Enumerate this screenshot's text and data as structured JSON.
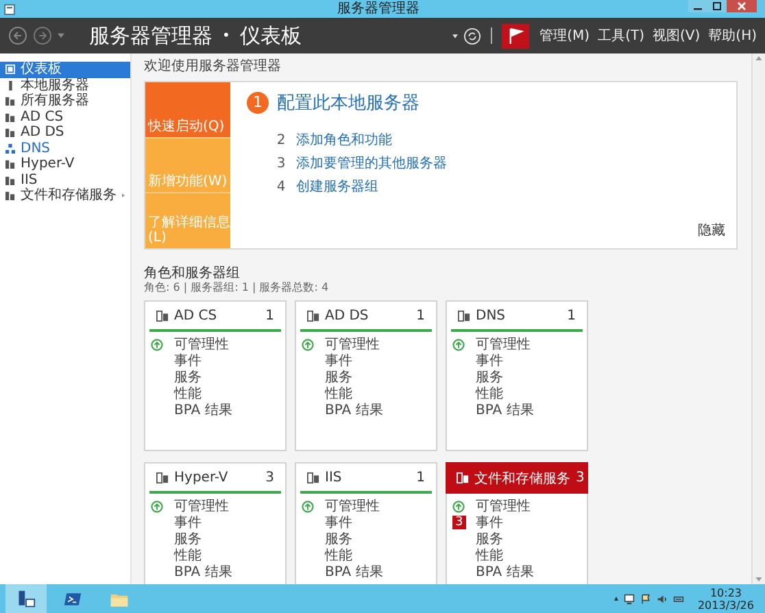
{
  "window": {
    "title": "服务器管理器"
  },
  "header": {
    "title": "服务器管理器",
    "separator": "•",
    "page": "仪表板",
    "menus": [
      "管理(M)",
      "工具(T)",
      "视图(V)",
      "帮助(H)"
    ]
  },
  "sidebar": {
    "items": [
      {
        "label": "仪表板",
        "selected": true,
        "highlighted": false,
        "expandable": false
      },
      {
        "label": "本地服务器",
        "selected": false,
        "highlighted": false,
        "expandable": false
      },
      {
        "label": "所有服务器",
        "selected": false,
        "highlighted": false,
        "expandable": false
      },
      {
        "label": "AD CS",
        "selected": false,
        "highlighted": false,
        "expandable": false
      },
      {
        "label": "AD DS",
        "selected": false,
        "highlighted": false,
        "expandable": false
      },
      {
        "label": "DNS",
        "selected": false,
        "highlighted": true,
        "expandable": false
      },
      {
        "label": "Hyper-V",
        "selected": false,
        "highlighted": false,
        "expandable": false
      },
      {
        "label": "IIS",
        "selected": false,
        "highlighted": false,
        "expandable": false
      },
      {
        "label": "文件和存储服务",
        "selected": false,
        "highlighted": false,
        "expandable": true
      }
    ]
  },
  "welcome": {
    "heading": "欢迎使用服务器管理器",
    "tabs": [
      {
        "label": "快速启动(Q)",
        "selected": true
      },
      {
        "label": "新增功能(W)",
        "selected": false
      },
      {
        "label": "了解详细信息(L)",
        "selected": false
      }
    ],
    "steps": [
      {
        "number": "1",
        "label": "配置此本地服务器",
        "kind": "primary"
      },
      {
        "number": "2",
        "label": "添加角色和功能",
        "kind": "secondary"
      },
      {
        "number": "3",
        "label": "添加要管理的其他服务器",
        "kind": "secondary"
      },
      {
        "number": "4",
        "label": "创建服务器组",
        "kind": "secondary"
      }
    ],
    "hide_link": "隐藏"
  },
  "groups": {
    "heading": "角色和服务器组",
    "summary": "角色: 6 | 服务器组: 1 | 服务器总数: 4",
    "tiles": [
      {
        "name": "AD CS",
        "count": "1",
        "kind": "ok",
        "rows": [
          {
            "label": "可管理性",
            "kind": "status"
          },
          {
            "label": "事件",
            "kind": "item"
          },
          {
            "label": "服务",
            "kind": "item"
          },
          {
            "label": "性能",
            "kind": "item"
          },
          {
            "label": "BPA 结果",
            "kind": "item"
          }
        ]
      },
      {
        "name": "AD DS",
        "count": "1",
        "kind": "ok",
        "rows": [
          {
            "label": "可管理性",
            "kind": "status"
          },
          {
            "label": "事件",
            "kind": "item"
          },
          {
            "label": "服务",
            "kind": "item"
          },
          {
            "label": "性能",
            "kind": "item"
          },
          {
            "label": "BPA 结果",
            "kind": "item"
          }
        ]
      },
      {
        "name": "DNS",
        "count": "1",
        "kind": "ok",
        "rows": [
          {
            "label": "可管理性",
            "kind": "status"
          },
          {
            "label": "事件",
            "kind": "item"
          },
          {
            "label": "服务",
            "kind": "item"
          },
          {
            "label": "性能",
            "kind": "item"
          },
          {
            "label": "BPA 结果",
            "kind": "item"
          }
        ]
      },
      {
        "name": "Hyper-V",
        "count": "3",
        "kind": "ok",
        "rows": [
          {
            "label": "可管理性",
            "kind": "status"
          },
          {
            "label": "事件",
            "kind": "item"
          },
          {
            "label": "服务",
            "kind": "item"
          },
          {
            "label": "性能",
            "kind": "item"
          },
          {
            "label": "BPA 结果",
            "kind": "item"
          }
        ]
      },
      {
        "name": "IIS",
        "count": "1",
        "kind": "ok",
        "rows": [
          {
            "label": "可管理性",
            "kind": "status"
          },
          {
            "label": "事件",
            "kind": "item"
          },
          {
            "label": "服务",
            "kind": "item"
          },
          {
            "label": "性能",
            "kind": "item"
          },
          {
            "label": "BPA 结果",
            "kind": "item"
          }
        ]
      },
      {
        "name": "文件和存储服务",
        "count": "3",
        "kind": "alert",
        "rows": [
          {
            "label": "可管理性",
            "kind": "status"
          },
          {
            "label": "事件",
            "kind": "item",
            "badge": "3"
          },
          {
            "label": "服务",
            "kind": "item"
          },
          {
            "label": "性能",
            "kind": "item"
          },
          {
            "label": "BPA 结果",
            "kind": "item"
          }
        ]
      }
    ]
  },
  "taskbar": {
    "apps": [
      {
        "selected": true
      },
      {
        "selected": false
      },
      {
        "selected": false
      }
    ],
    "time": "10:23",
    "date": "2013/3/26"
  }
}
